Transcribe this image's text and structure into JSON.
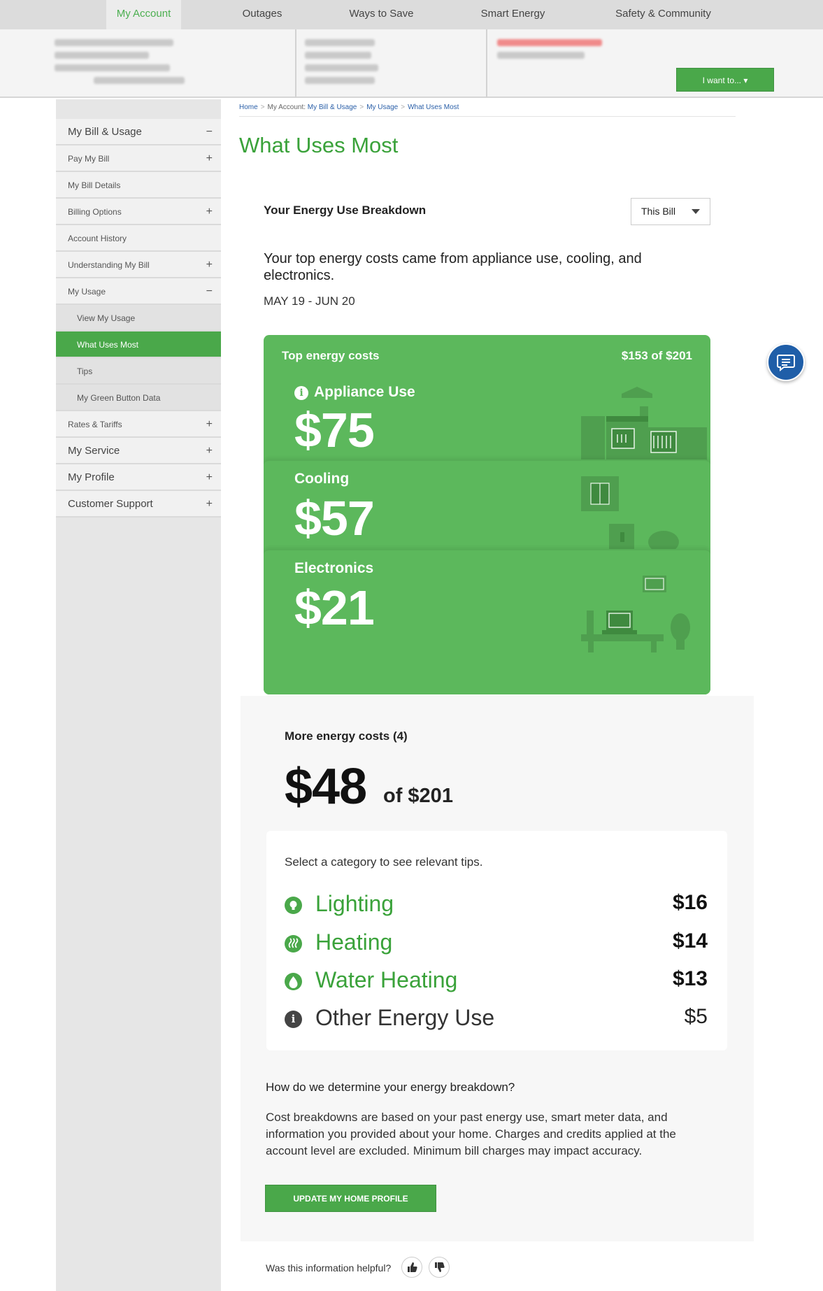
{
  "topnav": {
    "tabs": [
      "My Account",
      "Outages",
      "Ways to Save",
      "Smart Energy",
      "Safety & Community"
    ]
  },
  "header": {
    "i_want_to": "I want to... ▾"
  },
  "sidebar": {
    "items": [
      {
        "label": "My Bill & Usage",
        "sign": "−"
      },
      {
        "label": "Pay My Bill",
        "sign": "+"
      },
      {
        "label": "My Bill Details",
        "sign": ""
      },
      {
        "label": "Billing Options",
        "sign": "+"
      },
      {
        "label": "Account History",
        "sign": ""
      },
      {
        "label": "Understanding My Bill",
        "sign": "+"
      },
      {
        "label": "My Usage",
        "sign": "−"
      },
      {
        "label": "View My Usage",
        "sign": ""
      },
      {
        "label": "What Uses Most",
        "sign": ""
      },
      {
        "label": "Tips",
        "sign": ""
      },
      {
        "label": "My Green Button Data",
        "sign": ""
      },
      {
        "label": "Rates & Tariffs",
        "sign": "+"
      },
      {
        "label": "My Service",
        "sign": "+"
      },
      {
        "label": "My Profile",
        "sign": "+"
      },
      {
        "label": "Customer Support",
        "sign": "+"
      }
    ]
  },
  "breadcrumb": {
    "home": "Home",
    "my_account": "My Account:",
    "bill_usage": "My Bill & Usage",
    "my_usage": "My Usage",
    "current": "What Uses Most"
  },
  "main": {
    "title": "What Uses Most",
    "breakdown_title": "Your Energy Use Breakdown",
    "period_select": "This Bill",
    "summary": "Your top energy costs came from appliance use, cooling, and electronics.",
    "date_range": "MAY 19 - JUN 20"
  },
  "top_costs": {
    "heading": "Top energy costs",
    "total": "$153 of $201",
    "items": [
      {
        "label": "Appliance Use",
        "amount": "$75"
      },
      {
        "label": "Cooling",
        "amount": "$57"
      },
      {
        "label": "Electronics",
        "amount": "$21"
      }
    ]
  },
  "more_costs": {
    "title": "More energy costs (4)",
    "amount": "$48",
    "of_total": "of $201",
    "prompt": "Select a category to see relevant tips.",
    "categories": [
      {
        "name": "Lighting",
        "value": "$16",
        "icon": "lightbulb-icon"
      },
      {
        "name": "Heating",
        "value": "$14",
        "icon": "heat-icon"
      },
      {
        "name": "Water Heating",
        "value": "$13",
        "icon": "water-drop-icon"
      },
      {
        "name": "Other Energy Use",
        "value": "$5",
        "icon": "info-icon"
      }
    ]
  },
  "how": {
    "title": "How do we determine your energy breakdown?",
    "body": "Cost breakdowns are based on your past energy use, smart meter data, and information you provided about your home. Charges and credits applied at the account level are excluded. Minimum bill charges may impact accuracy.",
    "button": "UPDATE MY HOME PROFILE"
  },
  "feedback": {
    "question": "Was this information helpful?"
  },
  "colors": {
    "brand_green": "#5cb85c",
    "accent_green": "#3aa23a",
    "link_blue": "#2a5fa8",
    "chat_blue": "#1f5ea8"
  }
}
